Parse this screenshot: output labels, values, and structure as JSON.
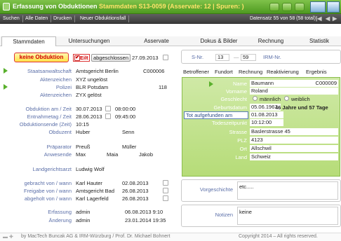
{
  "titlebar": {
    "title": "Erfassung von Obduktionen",
    "subtitle": "Stammdaten S13-0059 (Asservate: 12 | Spuren: )"
  },
  "toolbar": {
    "items": [
      "Suchen",
      "Alle Daten",
      "Drucken",
      "Neuer Obduktionsfall"
    ],
    "record_info": "Datensatz 55 von 58 (58 total)"
  },
  "tabs": [
    "Stammdaten",
    "Untersuchungen",
    "Asservate",
    "Dokus & Bilder",
    "Rechnung",
    "Statistik"
  ],
  "status": {
    "keine_obduktion": "keine Obduktion",
    "eilt": "Eilt",
    "abgeschlossen": "abgeschlossen",
    "date": "27.09.2013"
  },
  "left": {
    "staatsanwaltschaft": {
      "label": "Staatsanwaltschaft",
      "value": "Amtsgericht Berlin",
      "code": "C000006"
    },
    "aktenzeichen1": {
      "label": "Aktenzeichen",
      "value": "XYZ ungelöst"
    },
    "polizei": {
      "label": "Polizei",
      "value": "BLR Potsdam",
      "code": "118"
    },
    "aktenzeichen2": {
      "label": "Aktenzeichen",
      "value": "ZYX gelöst"
    },
    "obduktion_am": {
      "label": "Obduktion am / Zeit",
      "date": "30.07.2013",
      "time": "08:00:00"
    },
    "entnahmetag": {
      "label": "Entnahmetag / Zeit",
      "date": "28.06.2013",
      "time": "09:45:00"
    },
    "obduktionsende": {
      "label": "Obduktionsende (Zeit)",
      "time": "10:15"
    },
    "obduzent": {
      "label": "Obduzent",
      "name1": "Huber",
      "name2": "Senn"
    },
    "praeparator": {
      "label": "Präparator",
      "name1": "Preuß",
      "name2": "Müller"
    },
    "anwesende": {
      "label": "Anwesende",
      "name1": "Max",
      "name2": "Maia",
      "name3": "Jakob"
    },
    "landgerichtsarzt": {
      "label": "Landgerichtsarzt",
      "value": "Ludwig Wolf"
    },
    "gebracht": {
      "label": "gebracht von / wann",
      "who": "Karl Hauter",
      "date": "02.08.2013"
    },
    "freigabe": {
      "label": "Freigabe von / wann",
      "who": "Amtsgericht Bad",
      "date": "26.08.2013"
    },
    "abgeholt": {
      "label": "abgeholt von / wann",
      "who": "Karl Lagerfeld",
      "date": "26.08.2013"
    },
    "erfassung": {
      "label": "Erfassung",
      "who": "admin",
      "date": "06.08.2013 9:10"
    },
    "aenderung": {
      "label": "Änderung",
      "who": "admin",
      "date": "23.01.2014 19:35"
    }
  },
  "right": {
    "snr_label": "S-Nr.",
    "snr_a": "13",
    "snr_b": "59",
    "irm_label": "IRM-Nr.",
    "subtabs": [
      "Betroffener",
      "Fundort",
      "Rechnung",
      "Reaktivierung",
      "Ergebnis"
    ],
    "name": {
      "label": "Name",
      "value": "Baumann",
      "code": "C000009"
    },
    "vorname": {
      "label": "Vorname",
      "value": "Roland"
    },
    "geschlecht": {
      "label": "Geschlecht",
      "opt1": "männlich",
      "opt2": "weiblich"
    },
    "geburtsdatum": {
      "label": "Geburtsdatum",
      "value": "05.06.1967",
      "age": "46 Jahre und 57 Tage"
    },
    "tot_aufgefunden": {
      "label": "Tot aufgefunden am",
      "value": "01.08.2013"
    },
    "todeszeitpunkt": {
      "label": "Todeszeitpunkt",
      "value": "10:12:00"
    },
    "strasse": {
      "label": "Strasse",
      "value": "Baslerstrasse 45"
    },
    "plz": {
      "label": "PLZ",
      "value": "4123"
    },
    "ort": {
      "label": "Ort",
      "value": "Allschwil"
    },
    "land": {
      "label": "Land",
      "value": "Schweiz"
    },
    "vorgeschichte": {
      "label": "Vorgeschichte",
      "value": "etc....."
    },
    "notizen": {
      "label": "Notizen",
      "value": "keine"
    }
  },
  "footer": {
    "credit": "by MacTech Buncak AG & IRM-Würzburg / Prof. Dr. Michael Bohnert",
    "copyright": "Copyright 2014 – All rights reserved."
  },
  "colors": {
    "accent_green": "#59b02c",
    "label_blue": "#5b6fa8",
    "alert_red": "#d10000"
  }
}
